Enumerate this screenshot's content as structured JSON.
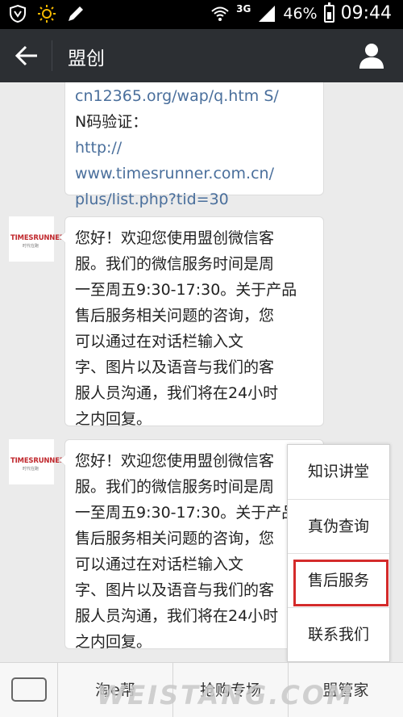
{
  "status_bar": {
    "network": "3G",
    "battery": "46%",
    "time": "09:44"
  },
  "nav": {
    "title": "盟创"
  },
  "messages": [
    {
      "lines": [
        "cn12365.org/wap/q.htm  S/",
        "N码验证：",
        "http://",
        "www.timesrunner.com.cn/",
        "plus/list.php?tid=30"
      ]
    },
    {
      "lines": [
        "您好！欢迎您使用盟创微信客",
        "服。我们的微信服务时间是周",
        "一至周五9:30-17:30。关于产品",
        "售后服务相关问题的咨询，您",
        "可以通过在对话栏输入文",
        "字、图片以及语音与我们的客",
        "服人员沟通，我们将在24小时",
        "之内回复。"
      ]
    },
    {
      "lines": [
        "您好！欢迎您使用盟创微信客",
        "服。我们的微信服务时间是周",
        "一至周五9:30-17:30。关于产品",
        "售后服务相关问题的咨询，您",
        "可以通过在对话栏输入文",
        "字、图片以及语音与我们的客",
        "服人员沟通，我们将在24小时",
        "之内回复。"
      ]
    }
  ],
  "avatar": {
    "logo_text": "TIMESRUNNER",
    "logo_sub": "时代在跑"
  },
  "popup_menu": {
    "items": [
      "知识讲堂",
      "真伪查询",
      "售后服务",
      "联系我们"
    ],
    "selected": "售后服务"
  },
  "bottom_menu": {
    "items": [
      "淘e帮",
      "抢购专场",
      "盟管家"
    ]
  },
  "watermark": "WEISTANG.COM",
  "colors": {
    "nav_bg": "#2c2f33",
    "link": "#4a6f9c",
    "highlight": "#d42b2b"
  }
}
